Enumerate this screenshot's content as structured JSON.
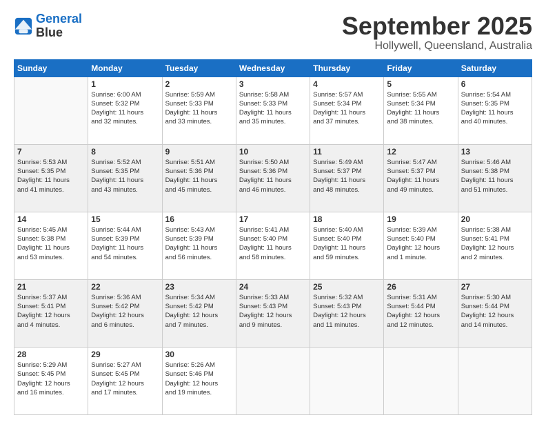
{
  "header": {
    "logo_line1": "General",
    "logo_line2": "Blue",
    "month": "September 2025",
    "location": "Hollywell, Queensland, Australia"
  },
  "weekdays": [
    "Sunday",
    "Monday",
    "Tuesday",
    "Wednesday",
    "Thursday",
    "Friday",
    "Saturday"
  ],
  "weeks": [
    [
      {
        "day": "",
        "detail": ""
      },
      {
        "day": "1",
        "detail": "Sunrise: 6:00 AM\nSunset: 5:32 PM\nDaylight: 11 hours\nand 32 minutes."
      },
      {
        "day": "2",
        "detail": "Sunrise: 5:59 AM\nSunset: 5:33 PM\nDaylight: 11 hours\nand 33 minutes."
      },
      {
        "day": "3",
        "detail": "Sunrise: 5:58 AM\nSunset: 5:33 PM\nDaylight: 11 hours\nand 35 minutes."
      },
      {
        "day": "4",
        "detail": "Sunrise: 5:57 AM\nSunset: 5:34 PM\nDaylight: 11 hours\nand 37 minutes."
      },
      {
        "day": "5",
        "detail": "Sunrise: 5:55 AM\nSunset: 5:34 PM\nDaylight: 11 hours\nand 38 minutes."
      },
      {
        "day": "6",
        "detail": "Sunrise: 5:54 AM\nSunset: 5:35 PM\nDaylight: 11 hours\nand 40 minutes."
      }
    ],
    [
      {
        "day": "7",
        "detail": "Sunrise: 5:53 AM\nSunset: 5:35 PM\nDaylight: 11 hours\nand 41 minutes."
      },
      {
        "day": "8",
        "detail": "Sunrise: 5:52 AM\nSunset: 5:35 PM\nDaylight: 11 hours\nand 43 minutes."
      },
      {
        "day": "9",
        "detail": "Sunrise: 5:51 AM\nSunset: 5:36 PM\nDaylight: 11 hours\nand 45 minutes."
      },
      {
        "day": "10",
        "detail": "Sunrise: 5:50 AM\nSunset: 5:36 PM\nDaylight: 11 hours\nand 46 minutes."
      },
      {
        "day": "11",
        "detail": "Sunrise: 5:49 AM\nSunset: 5:37 PM\nDaylight: 11 hours\nand 48 minutes."
      },
      {
        "day": "12",
        "detail": "Sunrise: 5:47 AM\nSunset: 5:37 PM\nDaylight: 11 hours\nand 49 minutes."
      },
      {
        "day": "13",
        "detail": "Sunrise: 5:46 AM\nSunset: 5:38 PM\nDaylight: 11 hours\nand 51 minutes."
      }
    ],
    [
      {
        "day": "14",
        "detail": "Sunrise: 5:45 AM\nSunset: 5:38 PM\nDaylight: 11 hours\nand 53 minutes."
      },
      {
        "day": "15",
        "detail": "Sunrise: 5:44 AM\nSunset: 5:39 PM\nDaylight: 11 hours\nand 54 minutes."
      },
      {
        "day": "16",
        "detail": "Sunrise: 5:43 AM\nSunset: 5:39 PM\nDaylight: 11 hours\nand 56 minutes."
      },
      {
        "day": "17",
        "detail": "Sunrise: 5:41 AM\nSunset: 5:40 PM\nDaylight: 11 hours\nand 58 minutes."
      },
      {
        "day": "18",
        "detail": "Sunrise: 5:40 AM\nSunset: 5:40 PM\nDaylight: 11 hours\nand 59 minutes."
      },
      {
        "day": "19",
        "detail": "Sunrise: 5:39 AM\nSunset: 5:40 PM\nDaylight: 12 hours\nand 1 minute."
      },
      {
        "day": "20",
        "detail": "Sunrise: 5:38 AM\nSunset: 5:41 PM\nDaylight: 12 hours\nand 2 minutes."
      }
    ],
    [
      {
        "day": "21",
        "detail": "Sunrise: 5:37 AM\nSunset: 5:41 PM\nDaylight: 12 hours\nand 4 minutes."
      },
      {
        "day": "22",
        "detail": "Sunrise: 5:36 AM\nSunset: 5:42 PM\nDaylight: 12 hours\nand 6 minutes."
      },
      {
        "day": "23",
        "detail": "Sunrise: 5:34 AM\nSunset: 5:42 PM\nDaylight: 12 hours\nand 7 minutes."
      },
      {
        "day": "24",
        "detail": "Sunrise: 5:33 AM\nSunset: 5:43 PM\nDaylight: 12 hours\nand 9 minutes."
      },
      {
        "day": "25",
        "detail": "Sunrise: 5:32 AM\nSunset: 5:43 PM\nDaylight: 12 hours\nand 11 minutes."
      },
      {
        "day": "26",
        "detail": "Sunrise: 5:31 AM\nSunset: 5:44 PM\nDaylight: 12 hours\nand 12 minutes."
      },
      {
        "day": "27",
        "detail": "Sunrise: 5:30 AM\nSunset: 5:44 PM\nDaylight: 12 hours\nand 14 minutes."
      }
    ],
    [
      {
        "day": "28",
        "detail": "Sunrise: 5:29 AM\nSunset: 5:45 PM\nDaylight: 12 hours\nand 16 minutes."
      },
      {
        "day": "29",
        "detail": "Sunrise: 5:27 AM\nSunset: 5:45 PM\nDaylight: 12 hours\nand 17 minutes."
      },
      {
        "day": "30",
        "detail": "Sunrise: 5:26 AM\nSunset: 5:46 PM\nDaylight: 12 hours\nand 19 minutes."
      },
      {
        "day": "",
        "detail": ""
      },
      {
        "day": "",
        "detail": ""
      },
      {
        "day": "",
        "detail": ""
      },
      {
        "day": "",
        "detail": ""
      }
    ]
  ]
}
